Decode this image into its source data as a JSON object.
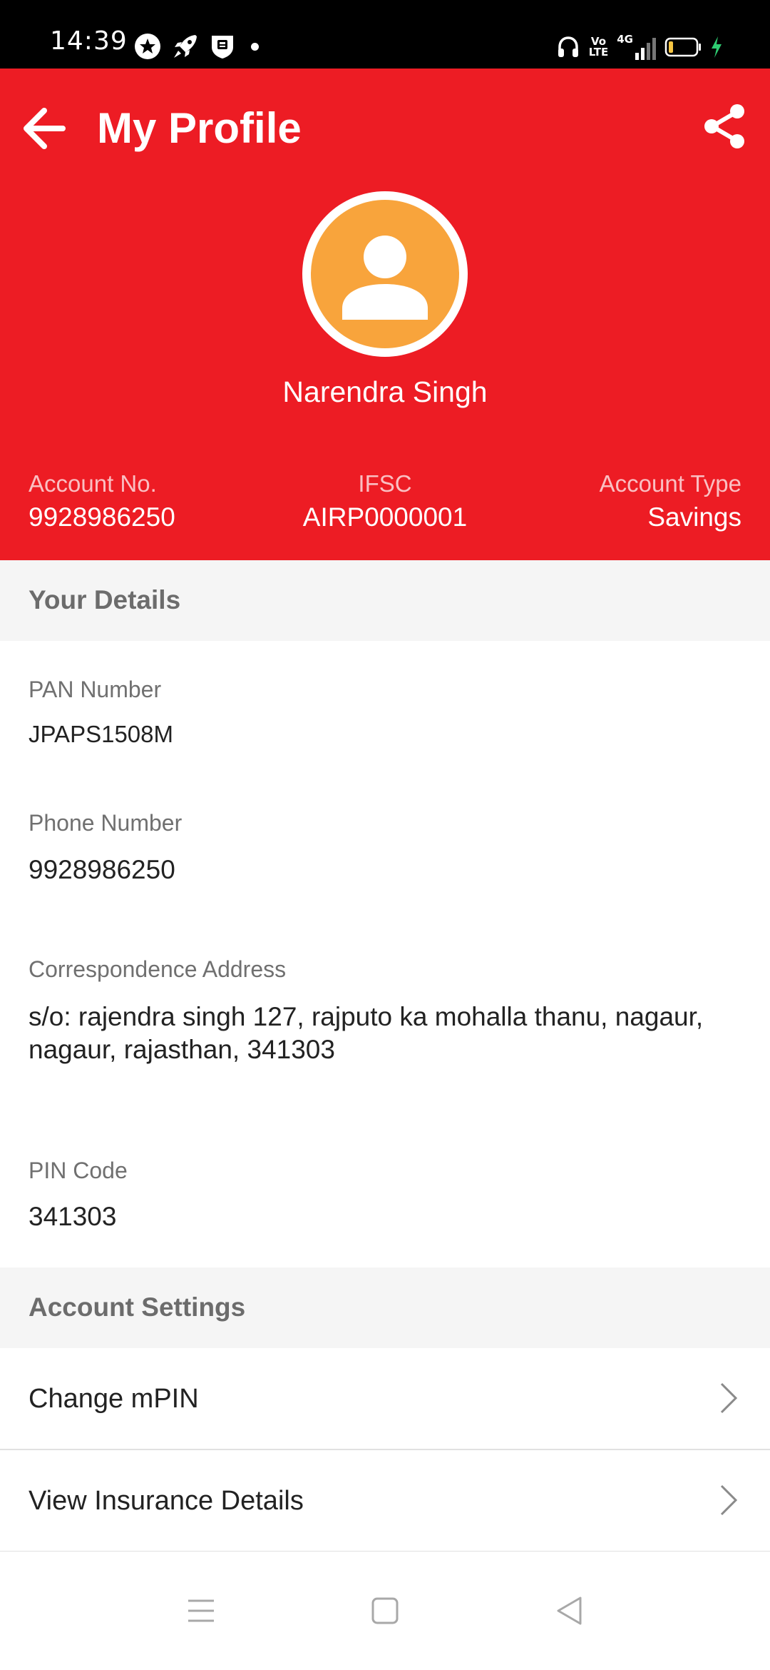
{
  "status_bar": {
    "time": "14:39",
    "left_icons": [
      "star-circle-icon",
      "rocket-icon",
      "shield-badge-icon",
      "dot-icon"
    ],
    "right_icons": [
      "headphones-icon",
      "volte-icon",
      "signal-4g-icon",
      "battery-icon",
      "charging-icon"
    ],
    "volte_text_top": "Vo",
    "volte_text_bottom": "LTE",
    "network_text": "4G",
    "battery_color": "#f5c542",
    "charging_color": "#2ecc71"
  },
  "header": {
    "title": "My Profile",
    "back_icon": "arrow-left-icon",
    "share_icon": "share-icon",
    "background_color": "#ed1c24"
  },
  "profile": {
    "avatar_icon": "user-icon",
    "avatar_color": "#f8a43c",
    "name": "Narendra Singh"
  },
  "account": {
    "account_no_label": "Account No.",
    "account_no": "9928986250",
    "ifsc_label": "IFSC",
    "ifsc": "AIRP0000001",
    "type_label": "Account Type",
    "type": "Savings"
  },
  "details": {
    "section_title": "Your Details",
    "pan_label": "PAN Number",
    "pan": "JPAPS1508M",
    "phone_label": "Phone Number",
    "phone": "9928986250",
    "address_label": "Correspondence Address",
    "address": "s/o: rajendra singh 127, rajputo ka mohalla thanu, nagaur, nagaur, rajasthan, 341303",
    "pin_label": "PIN Code",
    "pin": "341303"
  },
  "settings": {
    "section_title": "Account Settings",
    "items": [
      {
        "label": "Change mPIN",
        "icon": "chevron-right-icon"
      },
      {
        "label": "View Insurance Details",
        "icon": "chevron-right-icon"
      }
    ]
  },
  "nav_bar": {
    "icons": [
      "menu-icon",
      "home-square-icon",
      "back-triangle-icon"
    ]
  }
}
